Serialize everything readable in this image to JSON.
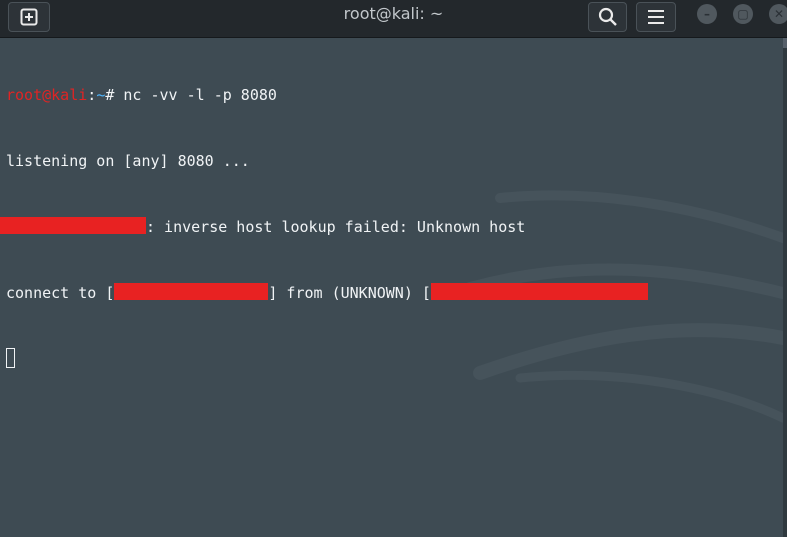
{
  "window": {
    "title": "root@kali: ~"
  },
  "toolbar": {
    "new_tab_icon": "plus-square-icon",
    "search_icon": "search-icon",
    "menu_icon": "hamburger-menu-icon"
  },
  "controls": {
    "minimize": "–",
    "maximize": "▢",
    "close": "✕"
  },
  "terminal": {
    "prompt_user": "root@kali",
    "prompt_sep": ":",
    "prompt_path": "~",
    "prompt_symbol": "# ",
    "command": "nc -vv -l -p 8080",
    "line2": "listening on [any] 8080 ...",
    "line3_suffix": ": inverse host lookup failed: Unknown host",
    "line4_prefix": "connect to [",
    "line4_mid": "] from (UNKNOWN) [",
    "colors": {
      "user": "#e02424",
      "path": "#4fb7ff",
      "text": "#f0f3f5",
      "redaction": "#e82222"
    }
  }
}
